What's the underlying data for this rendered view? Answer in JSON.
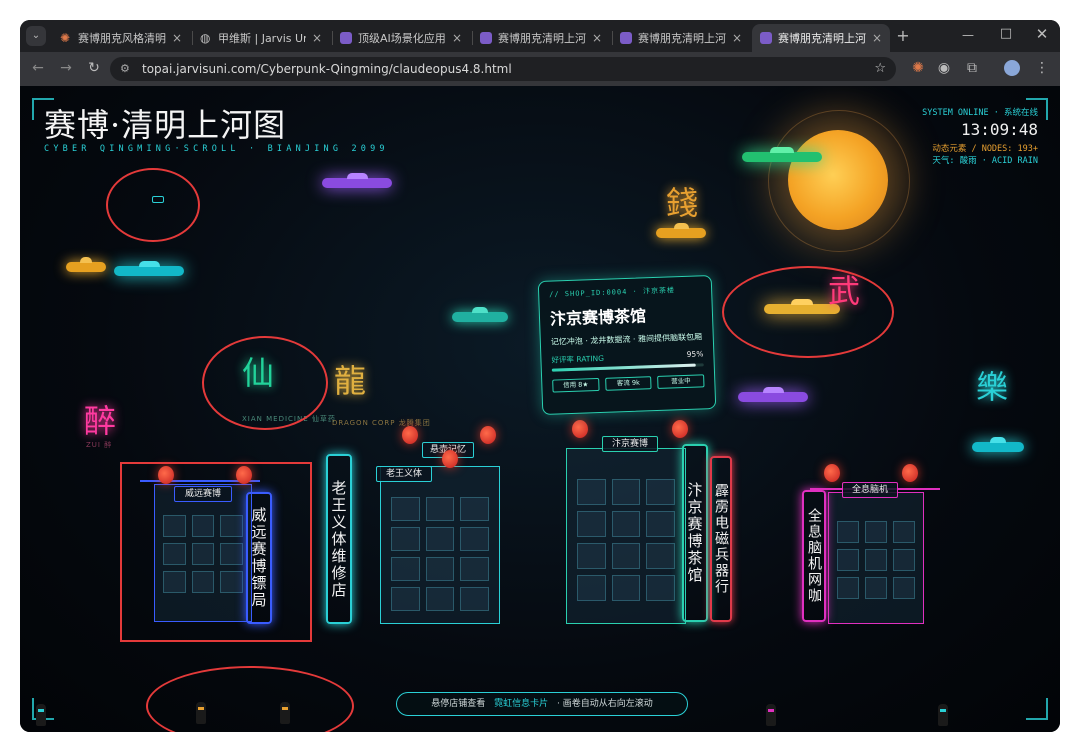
{
  "browser": {
    "tabs": [
      {
        "label": "赛博朋克风格清明上",
        "icon": "claude-icon",
        "active": false
      },
      {
        "label": "甲维斯 | Jarvis Uni",
        "icon": "globe-icon",
        "active": false
      },
      {
        "label": "顶级AI场景化应用测",
        "icon": "app-icon",
        "active": false
      },
      {
        "label": "赛博朋克清明上河图",
        "icon": "app-icon",
        "active": false
      },
      {
        "label": "赛博朋克清明上河图",
        "icon": "app-icon",
        "active": false
      },
      {
        "label": "赛博朋克清明上河图",
        "icon": "app-icon",
        "active": true
      }
    ],
    "url": "topai.jarvisuni.com/Cyberpunk-Qingming/claudeopus4.8.html",
    "new_tab": "+",
    "close_tab": "×"
  },
  "page": {
    "title": "赛博·清明上河图",
    "subtitle": "CYBER QINGMING·SCROLL · BIANJING 2099",
    "status": {
      "online": "SYSTEM ONLINE · 系统在线",
      "clock": "13:09:48",
      "nodes": "动态元素 / NODES: 193+",
      "weather": "天气: 酸雨 · ACID RAIN"
    },
    "neon_glyphs": [
      {
        "char": "錢",
        "color": "#e8a030"
      },
      {
        "char": "武",
        "color": "#ff3a7a"
      },
      {
        "char": "仙",
        "color": "#22d39a"
      },
      {
        "char": "龍",
        "color": "#e0b040"
      },
      {
        "char": "醉",
        "color": "#ff3aa0"
      },
      {
        "char": "樂",
        "color": "#2ad0d6"
      }
    ],
    "neon_captions": {
      "sub_xian": "XIAN MEDICINE 仙草药",
      "sub_long": "DRAGON CORP 龙腾集团",
      "sub_zui": "ZUI 醉"
    },
    "card": {
      "id_line": "// SHOP_ID:0004 · 汴京茶楼",
      "name": "汴京赛博茶馆",
      "desc": "记忆冲泡 · 龙井数据流 · 雅间提供脑联包厢",
      "rating_label": "好评率 RATING",
      "rating_value": "95%",
      "rating": 0.95,
      "buttons": [
        "信用 8★",
        "客流 9k",
        "营业中"
      ]
    },
    "shops": {
      "weiyuan": {
        "plate": "威远赛博",
        "sign": "威远赛博镖局"
      },
      "laowang": {
        "plate": "老王义体",
        "sign": "老王义体维修店"
      },
      "memory": {
        "plate": "悬壶记忆"
      },
      "teahouse": {
        "plate": "汴京赛博",
        "sign": "汴京赛博茶馆"
      },
      "thunder": {
        "sign": "霹雳电磁兵器行"
      },
      "holo": {
        "plate": "全息脑机",
        "sign": "全息脑机网咖"
      }
    },
    "hint": {
      "text1": "悬停店铺查看",
      "highlight": "霓虹信息卡片",
      "text2": "· 画卷自动从右向左滚动"
    }
  }
}
